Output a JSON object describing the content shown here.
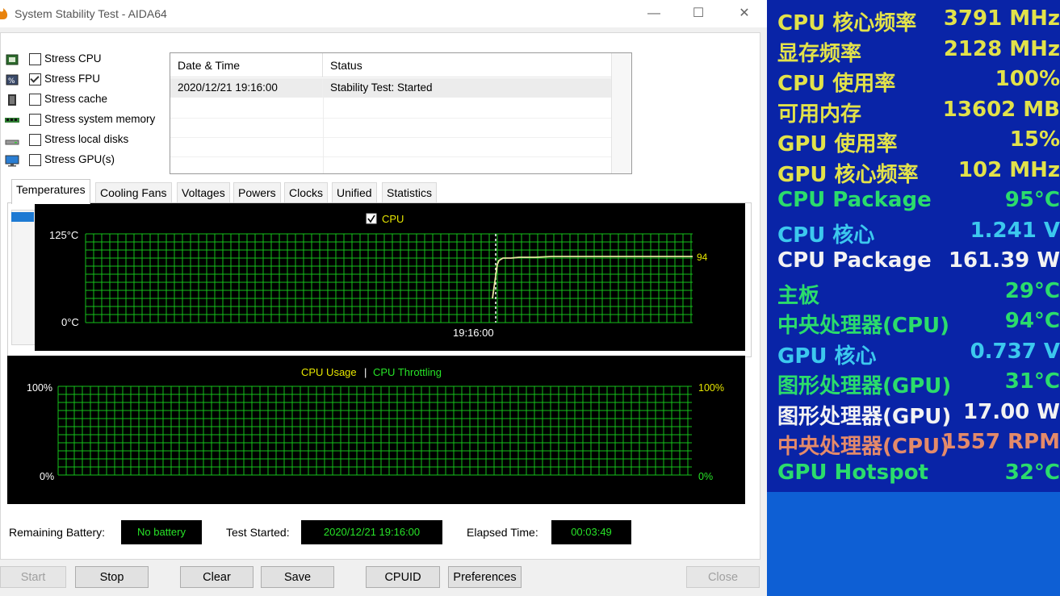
{
  "window": {
    "title": "System Stability Test - AIDA64",
    "minimize_glyph": "—",
    "maximize_glyph": "☐",
    "close_glyph": "✕"
  },
  "stress_options": [
    {
      "label": "Stress CPU",
      "checked": false,
      "icon": "cpu-chip-icon"
    },
    {
      "label": "Stress FPU",
      "checked": true,
      "icon": "fpu-icon"
    },
    {
      "label": "Stress cache",
      "checked": false,
      "icon": "cache-icon"
    },
    {
      "label": "Stress system memory",
      "checked": false,
      "icon": "memory-module-icon"
    },
    {
      "label": "Stress local disks",
      "checked": false,
      "icon": "disk-icon"
    },
    {
      "label": "Stress GPU(s)",
      "checked": false,
      "icon": "monitor-icon"
    }
  ],
  "log": {
    "headers": [
      "Date & Time",
      "Status"
    ],
    "rows": [
      {
        "time": "2020/12/21 19:16:00",
        "status": "Stability Test: Started"
      }
    ]
  },
  "tabs": [
    "Temperatures",
    "Cooling Fans",
    "Voltages",
    "Powers",
    "Clocks",
    "Unified",
    "Statistics"
  ],
  "active_tab": "Temperatures",
  "temp_graph": {
    "legend": "CPU",
    "legend_checked": true,
    "y_top_label": "125°C",
    "y_bottom_label": "0°C",
    "x_marker_label": "19:16:00",
    "current_value_label": "94",
    "colors": {
      "grid": "#15c11a",
      "line": "#e6e6a0",
      "text": "#ffffff",
      "legend": "#e6e600"
    }
  },
  "usage_graph": {
    "legend_usage": "CPU Usage",
    "legend_sep": "|",
    "legend_throttling": "CPU Throttling",
    "y_top_left": "100%",
    "y_bottom_left": "0%",
    "y_top_right": "100%",
    "y_bottom_right": "0%",
    "colors": {
      "usage": "#e6e600",
      "throttling": "#27e327"
    }
  },
  "status": {
    "battery_label": "Remaining Battery:",
    "battery_value": "No battery",
    "started_label": "Test Started:",
    "started_value": "2020/12/21 19:16:00",
    "elapsed_label": "Elapsed Time:",
    "elapsed_value": "00:03:49"
  },
  "buttons": {
    "start": "Start",
    "stop": "Stop",
    "clear": "Clear",
    "save": "Save",
    "cpuid": "CPUID",
    "preferences": "Preferences",
    "close": "Close"
  },
  "osd": [
    {
      "label": "CPU 核心频率",
      "value": "3791 MHz",
      "color": "#e2e24a"
    },
    {
      "label": "显存频率",
      "value": "2128 MHz",
      "color": "#e2e24a"
    },
    {
      "label": "CPU 使用率",
      "value": "100%",
      "color": "#e2e24a"
    },
    {
      "label": "可用内存",
      "value": "13602 MB",
      "color": "#e2e24a"
    },
    {
      "label": "GPU 使用率",
      "value": "15%",
      "color": "#e2e24a"
    },
    {
      "label": "GPU 核心频率",
      "value": "102 MHz",
      "color": "#e2e24a"
    },
    {
      "label": "CPU Package",
      "value": "95°C",
      "color": "#2bdc6c"
    },
    {
      "label": "CPU 核心",
      "value": "1.241 V",
      "color": "#3cc8ee"
    },
    {
      "label": "CPU Package",
      "value": "161.39 W",
      "color": "#f2f2f2"
    },
    {
      "label": "主板",
      "value": "29°C",
      "color": "#2bdc6c"
    },
    {
      "label": "中央处理器(CPU)",
      "value": "94°C",
      "color": "#2bdc6c"
    },
    {
      "label": "GPU 核心",
      "value": "0.737 V",
      "color": "#3cc8ee"
    },
    {
      "label": "图形处理器(GPU)",
      "value": "31°C",
      "color": "#2bdc6c"
    },
    {
      "label": "图形处理器(GPU)",
      "value": "17.00 W",
      "color": "#f2f2f2"
    },
    {
      "label": "中央处理器(CPU)",
      "value": "1557 RPM",
      "color": "#e48a6a"
    },
    {
      "label": "GPU Hotspot",
      "value": "32°C",
      "color": "#2bdc6c"
    }
  ]
}
